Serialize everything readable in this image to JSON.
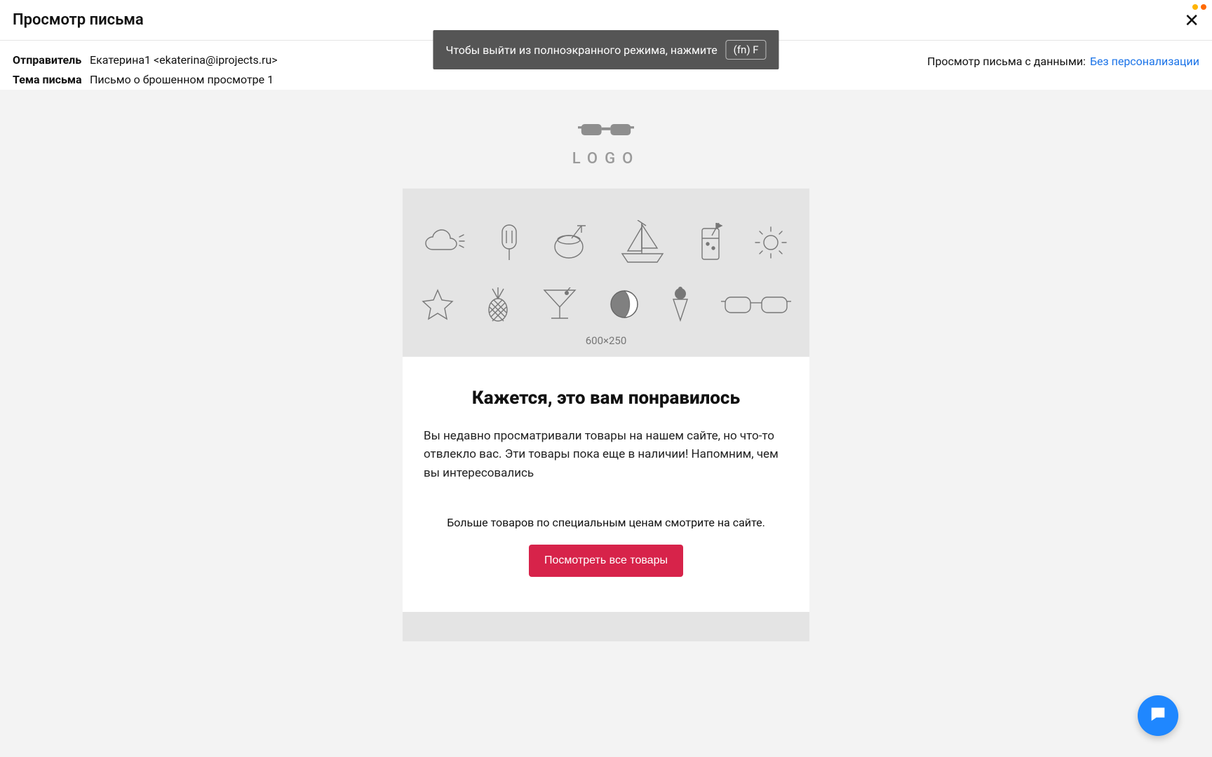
{
  "header": {
    "title": "Просмотр письма"
  },
  "meta": {
    "sender_label": "Отправитель",
    "sender_value": "Екатерина1 <ekaterina@iprojects.ru>",
    "subject_label": "Тема письма",
    "subject_value": "Письмо о брошенном просмотре 1",
    "preview_label": "Просмотр письма с данными:",
    "personalization_link": "Без персонализации"
  },
  "toast": {
    "text": "Чтобы выйти из полноэкранного режима, нажмите",
    "key": "(fn) F"
  },
  "email": {
    "logo_text": "LOGO",
    "hero_dim": "600×250",
    "headline": "Кажется, это вам понравилось",
    "body": "Вы недавно просматривали товары на нашем сайте, но что-то отвлекло вас. Эти товары пока еще в наличии! Напомним, чем вы интересовались",
    "subline": "Больше товаров по специальным ценам смотрите на сайте.",
    "cta": "Посмотреть все товары"
  },
  "status_dots": [
    "#ffb400",
    "#ff6a00"
  ]
}
